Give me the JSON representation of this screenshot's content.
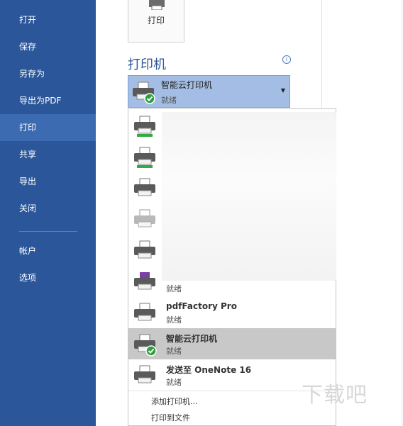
{
  "nav": {
    "items": [
      {
        "label": "打开"
      },
      {
        "label": "保存"
      },
      {
        "label": "另存为"
      },
      {
        "label": "导出为PDF"
      },
      {
        "label": "打印"
      },
      {
        "label": "共享"
      },
      {
        "label": "导出"
      },
      {
        "label": "关闭"
      },
      {
        "label": "帐户"
      },
      {
        "label": "选项"
      }
    ],
    "active_index": 4
  },
  "print_button": {
    "label": "打印"
  },
  "printer_section": {
    "title": "打印机",
    "info_icon": "info-icon",
    "selected": {
      "name": "智能云打印机",
      "status": "就绪"
    }
  },
  "printer_list": {
    "items": [
      {
        "name": "",
        "status": ""
      },
      {
        "name": "",
        "status": ""
      },
      {
        "name": "",
        "status": ""
      },
      {
        "name": "",
        "status": ""
      },
      {
        "name": "",
        "status": ""
      },
      {
        "name": "",
        "status": "就绪"
      },
      {
        "name": "pdfFactory Pro",
        "status": "就绪"
      },
      {
        "name": "智能云打印机",
        "status": "就绪"
      },
      {
        "name": "发送至 OneNote 16",
        "status": "就绪"
      }
    ],
    "selected_index": 7,
    "add_printer": "添加打印机...",
    "print_to_file": "打印到文件"
  },
  "watermark": "下载吧",
  "colors": {
    "nav_bg": "#2b579a",
    "nav_active": "#3c6bb2",
    "select_bg": "#a4bde4"
  }
}
